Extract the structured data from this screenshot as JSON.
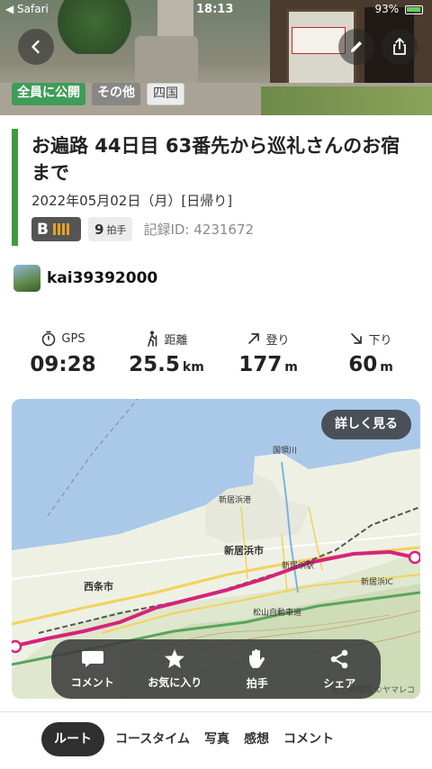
{
  "status_bar": {
    "back_app": "◀ Safari",
    "time": "18:13",
    "battery": "93%"
  },
  "header": {
    "tags": [
      "全員に公開",
      "その他",
      "四国"
    ]
  },
  "activity": {
    "title": "お遍路 44日目 63番先から巡礼さんのお宿まで",
    "date": "2022年05月02日（月）[日帰り]",
    "level": "B",
    "claps": "9",
    "claps_label": "拍手",
    "record_id": "記録ID: 4231672"
  },
  "user": {
    "name": "kai39392000"
  },
  "stats": [
    {
      "label": "GPS",
      "value": "09:28",
      "unit": "",
      "icon": "stopwatch-icon"
    },
    {
      "label": "距離",
      "value": "25.5",
      "unit": "km",
      "icon": "hiker-icon"
    },
    {
      "label": "登り",
      "value": "177",
      "unit": "m",
      "icon": "arrow-up-right-icon"
    },
    {
      "label": "下り",
      "value": "60",
      "unit": "m",
      "icon": "arrow-down-right-icon"
    }
  ],
  "map": {
    "detail_button": "詳しく見る",
    "credit": "国土地理院 ©ヤマレコ",
    "labels": {
      "city1": "新居浜市",
      "city2": "西条市",
      "port": "新居浜港",
      "station": "新居浜駅",
      "ic": "新居浜IC",
      "expressway": "松山自動車道",
      "river": "国領川"
    }
  },
  "actions": [
    {
      "label": "コメント",
      "icon": "comment-icon"
    },
    {
      "label": "お気に入り",
      "icon": "star-icon"
    },
    {
      "label": "拍手",
      "icon": "clap-hand-icon"
    },
    {
      "label": "シェア",
      "icon": "share-icon"
    }
  ],
  "tabs": [
    "ルート",
    "コースタイム",
    "写真",
    "感想",
    "コメント"
  ],
  "colors": {
    "accent_green": "#3f9c3c",
    "route": "#d6237a",
    "level_bars": "#e8a21c"
  }
}
